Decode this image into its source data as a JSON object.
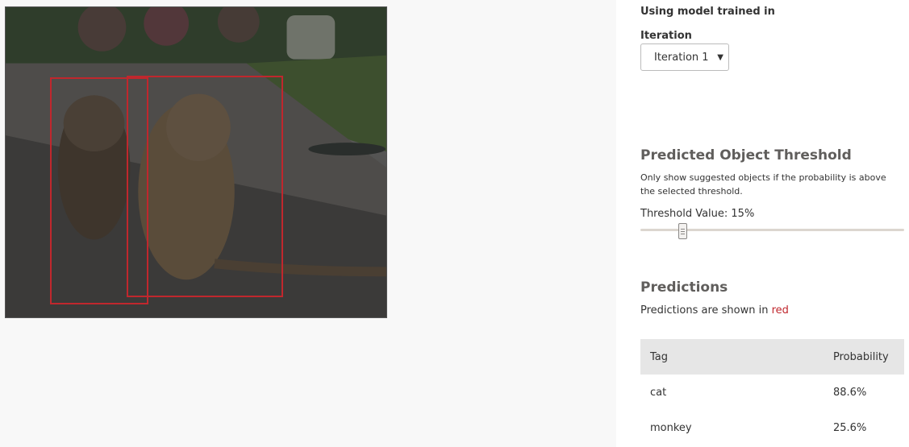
{
  "panel": {
    "model_label": "Using model trained in",
    "iteration_label": "Iteration",
    "iteration_selected": "Iteration 1",
    "threshold": {
      "title": "Predicted Object Threshold",
      "description": "Only show suggested objects if the probability is above the selected threshold.",
      "value_text": "Threshold Value: 15%",
      "value": 15
    },
    "predictions": {
      "title": "Predictions",
      "note_prefix": "Predictions are shown in ",
      "note_color_word": "red"
    },
    "table": {
      "headers": [
        "Tag",
        "Probability"
      ],
      "rows": [
        {
          "tag": "cat",
          "probability": "88.6%"
        },
        {
          "tag": "monkey",
          "probability": "25.6%"
        }
      ]
    }
  },
  "colors": {
    "bbox": "#c0272d",
    "header_bg": "#e6e6e6",
    "panel_bg": "#ffffff",
    "page_bg": "#f8f8f8"
  },
  "icons": {
    "select_caret": "chevron-down-icon",
    "slider_grip": "grip-icon"
  }
}
